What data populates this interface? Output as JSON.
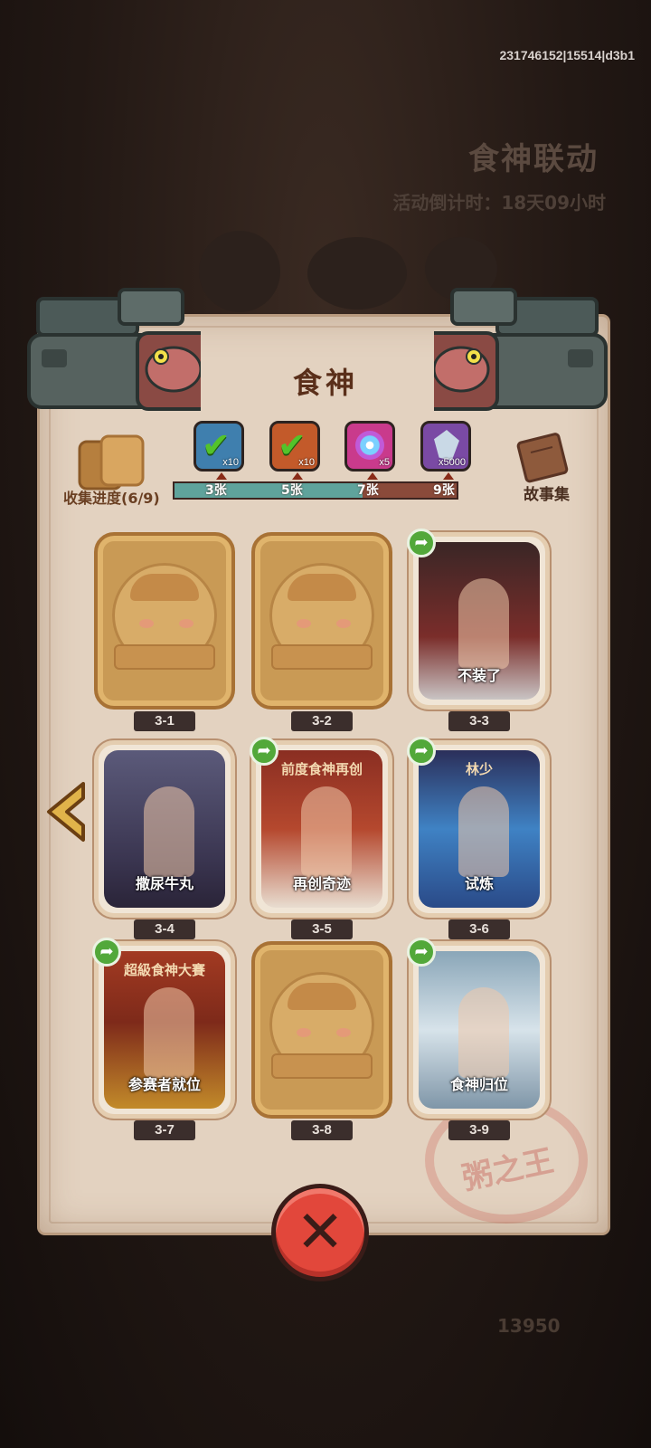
{
  "session_id": "231746152|15514|d3b1",
  "background": {
    "event_title": "食神联动",
    "countdown": "活动倒计时：18天09小时",
    "currency_count": "13950"
  },
  "panel": {
    "title": "食神",
    "collection_label": "收集进度(6/9)",
    "story_label": "故事集",
    "progress_fraction": 0.667
  },
  "rewards": [
    {
      "qty": "x10",
      "claimed": true,
      "threshold": "3张"
    },
    {
      "qty": "x10",
      "claimed": true,
      "threshold": "5张"
    },
    {
      "qty": "x5",
      "claimed": false,
      "threshold": "7张"
    },
    {
      "qty": "x5000",
      "claimed": false,
      "threshold": "9张"
    }
  ],
  "cards": [
    {
      "id": "3-1",
      "unlocked": false,
      "caption": ""
    },
    {
      "id": "3-2",
      "unlocked": false,
      "caption": ""
    },
    {
      "id": "3-3",
      "unlocked": true,
      "caption": "不装了"
    },
    {
      "id": "3-4",
      "unlocked": true,
      "caption": "撒尿牛丸"
    },
    {
      "id": "3-5",
      "unlocked": true,
      "caption": "再创奇迹"
    },
    {
      "id": "3-6",
      "unlocked": true,
      "caption": "试炼"
    },
    {
      "id": "3-7",
      "unlocked": true,
      "caption": "参赛者就位"
    },
    {
      "id": "3-8",
      "unlocked": false,
      "caption": ""
    },
    {
      "id": "3-9",
      "unlocked": true,
      "caption": "食神归位"
    }
  ],
  "card_art_text": {
    "newspaper_headline": "前度食神再创",
    "door_sign": "林少",
    "banner": "超級食神大賽"
  },
  "seal_text": "粥之王",
  "icons": {
    "nav_prev": "chevron-left-icon",
    "close": "close-icon",
    "share": "share-arrow-icon"
  }
}
